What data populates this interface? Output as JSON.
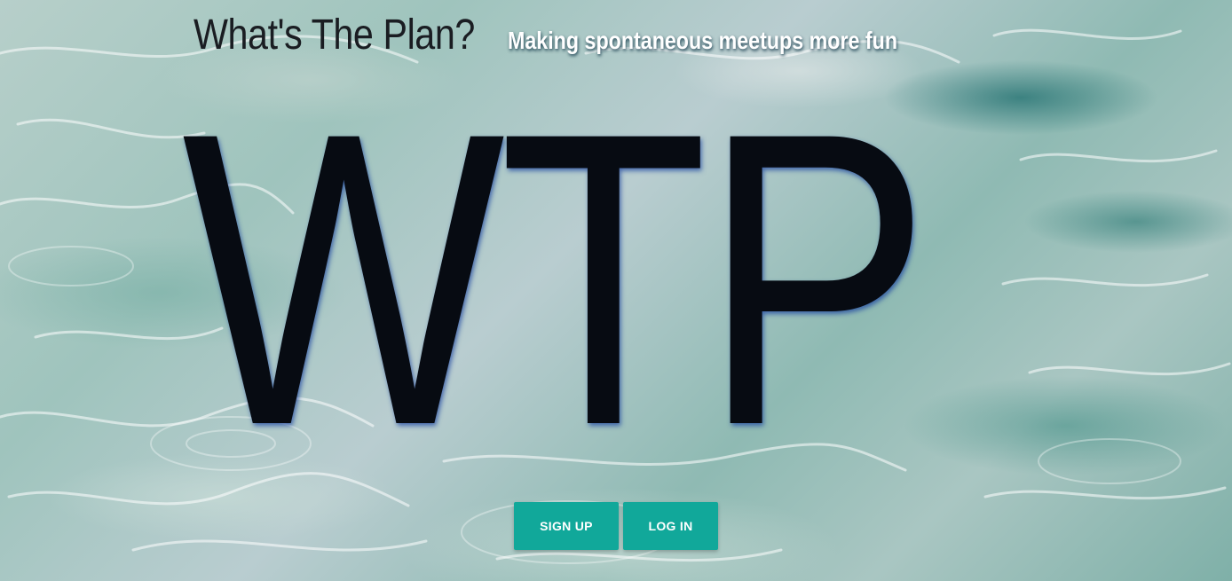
{
  "header": {
    "title": "What's The Plan?",
    "tagline": "Making spontaneous meetups more fun"
  },
  "hero": {
    "logo_text": "WTP"
  },
  "actions": {
    "signup_label": "SIGN UP",
    "login_label": "LOG IN"
  },
  "colors": {
    "accent": "#11a89a",
    "logo": "#070b12",
    "title": "#1a1d22"
  }
}
